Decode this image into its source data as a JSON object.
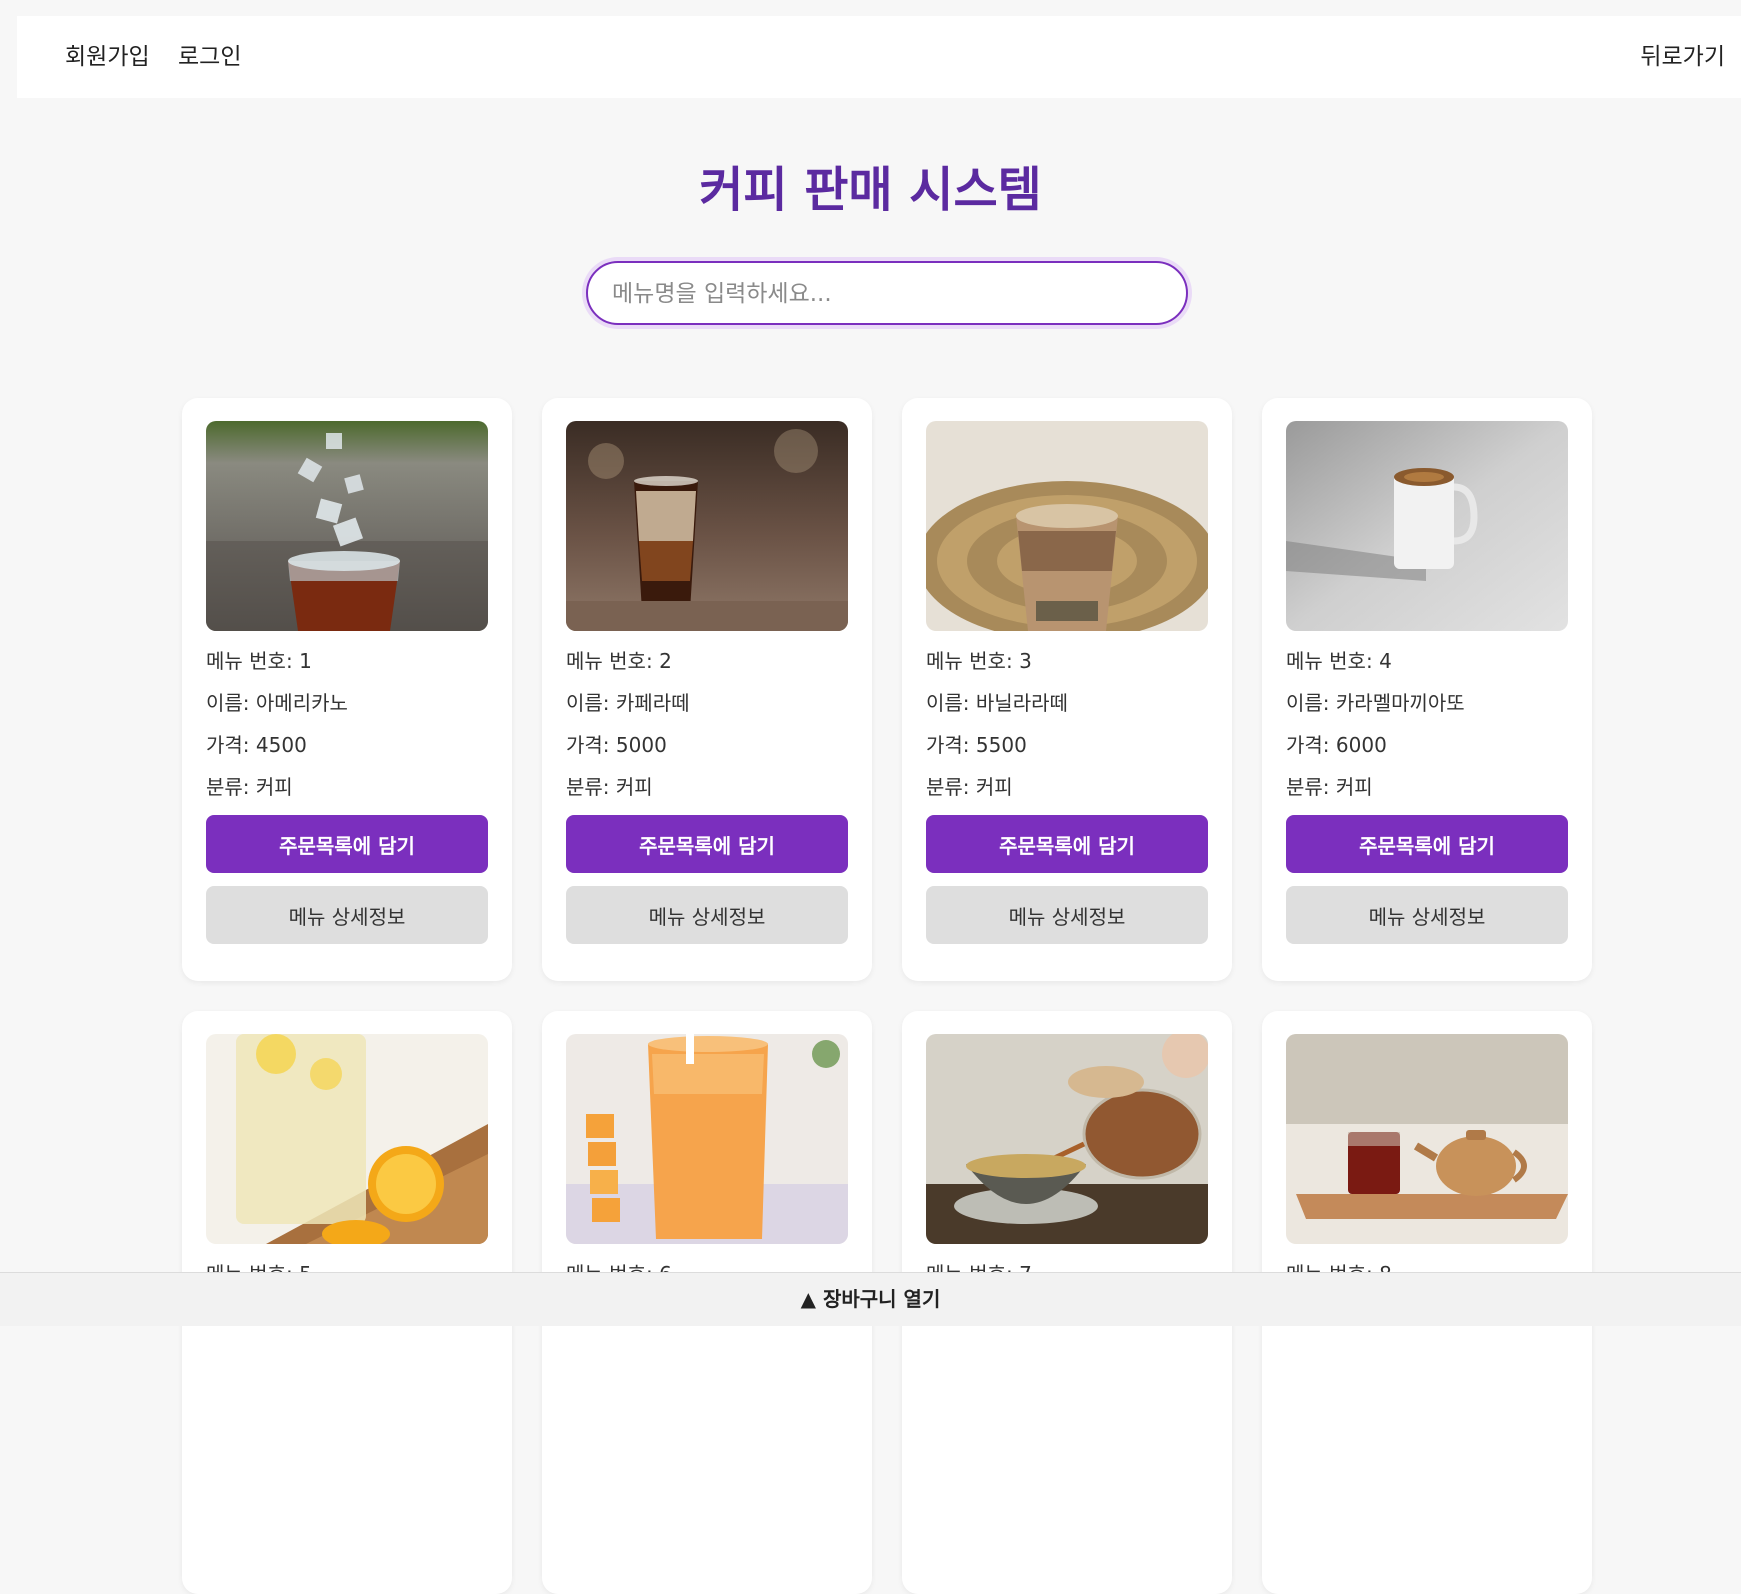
{
  "nav": {
    "signup": "회원가입",
    "login": "로그인",
    "back": "뒤로가기"
  },
  "page_title": "커피 판매 시스템",
  "search": {
    "placeholder": "메뉴명을 입력하세요...",
    "value": ""
  },
  "labels": {
    "menu_no": "메뉴 번호: ",
    "name": "이름: ",
    "price": "가격: ",
    "category": "분류: ",
    "add_button": "주문목록에 담기",
    "detail_button": "메뉴 상세정보"
  },
  "menus": [
    {
      "no": "1",
      "name": "아메리카노",
      "price": "4500",
      "category": "커피",
      "image": "iced-americano-photo"
    },
    {
      "no": "2",
      "name": "카페라떼",
      "price": "5000",
      "category": "커피",
      "image": "iced-cafe-latte-photo"
    },
    {
      "no": "3",
      "name": "바닐라라떼",
      "price": "5500",
      "category": "커피",
      "image": "vanilla-latte-photo"
    },
    {
      "no": "4",
      "name": "카라멜마끼아또",
      "price": "6000",
      "category": "커피",
      "image": "caramel-macchiato-photo"
    },
    {
      "no": "5",
      "name": "",
      "price": "",
      "category": "",
      "image": "lemonade-photo"
    },
    {
      "no": "6",
      "name": "",
      "price": "",
      "category": "",
      "image": "mango-smoothie-photo"
    },
    {
      "no": "7",
      "name": "",
      "price": "",
      "category": "",
      "image": "tea-pouring-photo"
    },
    {
      "no": "8",
      "name": "",
      "price": "",
      "category": "",
      "image": "teapot-set-photo"
    }
  ],
  "cart": {
    "toggle_label": "▲ 장바구니 열기"
  },
  "colors": {
    "accent": "#7b2fbe",
    "title": "#5b2aa0",
    "detail_button_bg": "#dedede",
    "page_bg": "#f7f7f7"
  }
}
